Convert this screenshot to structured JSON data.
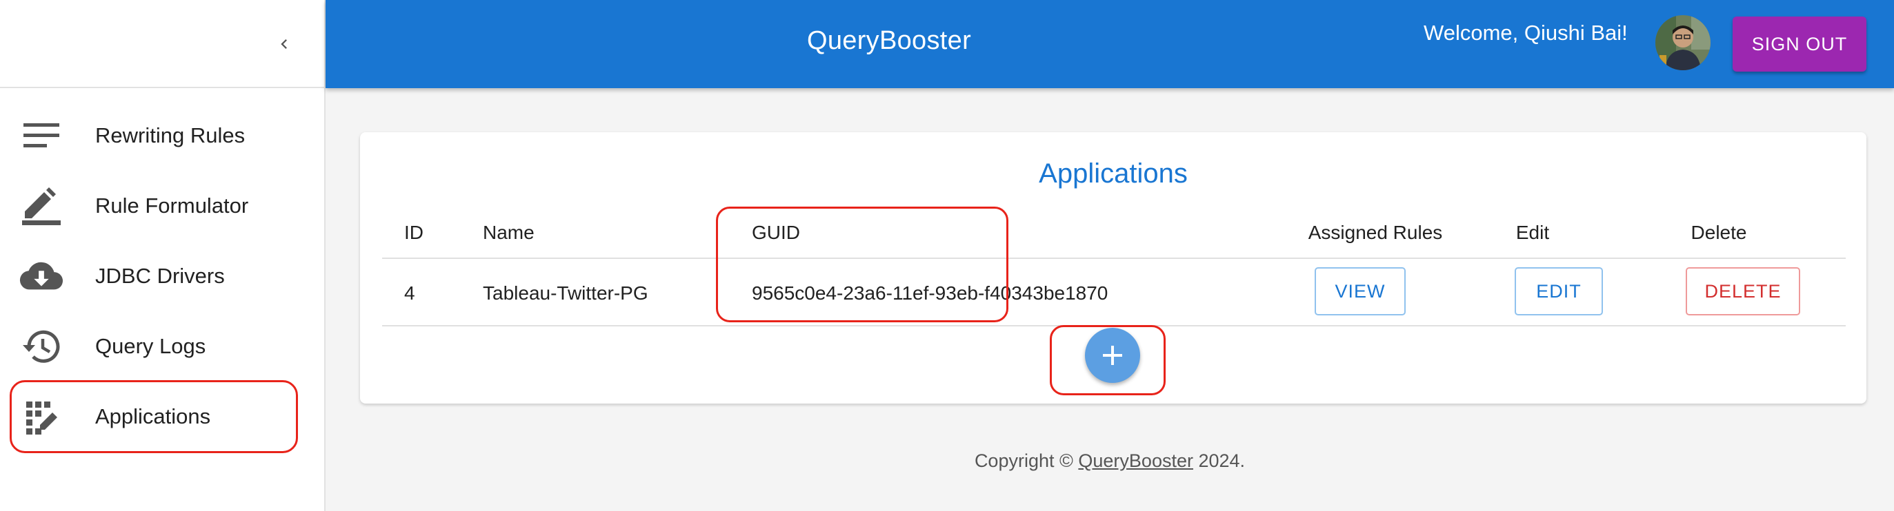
{
  "sidebar": {
    "collapse_icon": "chevron-left-icon",
    "items": [
      {
        "label": "Rewriting Rules",
        "icon": "list-icon"
      },
      {
        "label": "Rule Formulator",
        "icon": "edit-pen-icon"
      },
      {
        "label": "JDBC Drivers",
        "icon": "cloud-download-icon"
      },
      {
        "label": "Query Logs",
        "icon": "history-icon"
      },
      {
        "label": "Applications",
        "icon": "app-registration-icon",
        "selected": true
      }
    ]
  },
  "header": {
    "title": "QueryBooster",
    "welcome": "Welcome, Qiushi Bai!",
    "sign_out": "SIGN OUT"
  },
  "card": {
    "title": "Applications",
    "columns": {
      "id": "ID",
      "name": "Name",
      "guid": "GUID",
      "assigned_rules": "Assigned Rules",
      "edit": "Edit",
      "delete": "Delete"
    },
    "rows": [
      {
        "id": "4",
        "name": "Tableau-Twitter-PG",
        "guid": "9565c0e4-23a6-11ef-93eb-f40343be1870",
        "view_label": "VIEW",
        "edit_label": "EDIT",
        "delete_label": "DELETE"
      }
    ],
    "add_icon": "plus-icon"
  },
  "footer": {
    "prefix": "Copyright © ",
    "link": "QueryBooster",
    "suffix": " 2024."
  },
  "colors": {
    "appbar": "#1976d2",
    "sign_out": "#9c27b0",
    "fab": "#5c9fe2",
    "highlight": "#e8231a",
    "delete": "#d32f2f"
  }
}
